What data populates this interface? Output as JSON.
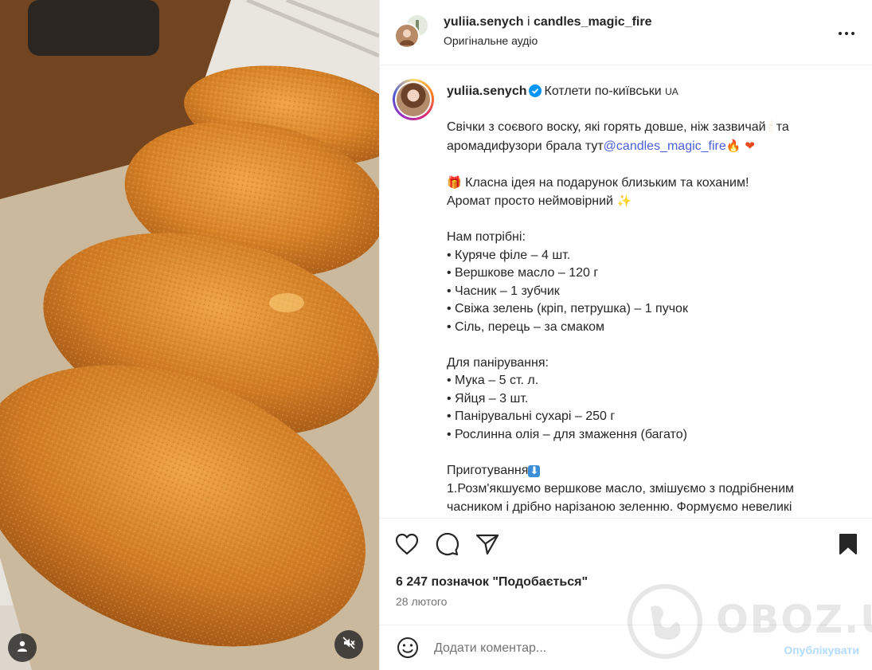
{
  "header": {
    "author": "yuliia.senych",
    "conjunction": "і",
    "collaborator": "candles_magic_fire",
    "audio": "Оригінальне аудіо"
  },
  "caption": {
    "username": "yuliia.senych",
    "title": "Котлети по-київськи",
    "title_badge": "UA",
    "intro_1": "Свічки з соєвого воску, які горять довше, ніж зазвичай",
    "intro_1_emoji": "🕯",
    "intro_1_end": "та",
    "intro_2": "аромадифузори брала тут",
    "mention": "@candles_magic_fire",
    "intro_2_emojis": "🔥 ❤",
    "gift_emoji": "🎁",
    "gift_text": "Класна ідея на подарунок близьким та коханим!",
    "aroma_text": "Аромат просто неймовірний",
    "aroma_emoji": "✨",
    "ingredients_title": "Нам потрібні:",
    "ingredients": [
      "• Куряче філе – 4 шт.",
      "• Вершкове масло – 120 г",
      "• Часник – 1 зубчик",
      "• Свіжа зелень (кріп, петрушка) – 1 пучок",
      "• Сіль, перець – за смаком"
    ],
    "breading_title": "Для панірування:",
    "breading": [
      "• Мука – 5 ст. л.",
      "• Яйця – 3 шт.",
      "• Панірувальні сухарі – 250 г",
      "• Рослинна олія – для змаження (багато)"
    ],
    "steps_title": "Приготування",
    "steps_emoji": "⬇",
    "step_1_line1": "1.Розм'якшуємо вершкове масло, змішуємо з подрібненим",
    "step_1_line2": "часником і дрібно нарізаною зеленню. Формуємо невеликі"
  },
  "actions": {
    "likes": "6 247 позначок \"Подобається\"",
    "date": "28 лютого"
  },
  "comment": {
    "placeholder": "Додати коментар...",
    "publish": "Опублікувати"
  },
  "watermark": {
    "text": "OBOZ.UA"
  },
  "colors": {
    "link": "#4a5fd8",
    "verified": "#0095f6",
    "publish_disabled": "#b3dbff"
  },
  "icons": {
    "more": "more-horizontal-icon",
    "like": "heart-icon",
    "comment": "comment-icon",
    "share": "send-icon",
    "save": "bookmark-icon",
    "emoji": "smile-icon",
    "user_tag": "user-icon",
    "mute": "speaker-muted-icon"
  }
}
